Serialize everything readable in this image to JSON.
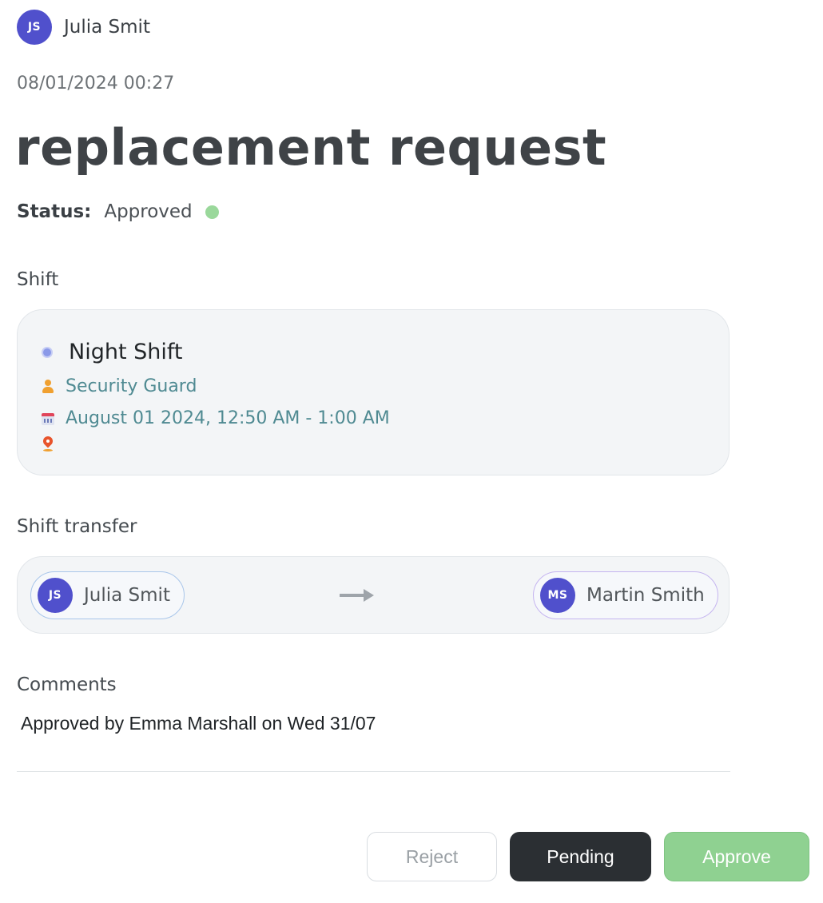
{
  "author": {
    "initials": "JS",
    "name": "Julia Smit",
    "avatar_color": "#5050cc"
  },
  "timestamp": "08/01/2024 00:27",
  "title": "replacement request",
  "status": {
    "label": "Status:",
    "value": "Approved",
    "dot_color": "#9ad89b"
  },
  "shift": {
    "section_label": "Shift",
    "name": "Night Shift",
    "role": "Security Guard",
    "datetime": "August 01 2024, 12:50 AM - 1:00 AM",
    "location": "",
    "icons": {
      "name": "shift-dot-icon",
      "role": "person-icon",
      "datetime": "calendar-icon",
      "location": "location-pin-icon"
    }
  },
  "transfer": {
    "section_label": "Shift transfer",
    "from": {
      "initials": "JS",
      "name": "Julia Smit"
    },
    "to": {
      "initials": "MS",
      "name": "Martin Smith"
    },
    "arrow_icon": "arrow-right-icon"
  },
  "comments": {
    "section_label": "Comments",
    "text": "Approved by Emma Marshall on Wed 31/07"
  },
  "actions": {
    "reject": "Reject",
    "pending": "Pending",
    "approve": "Approve",
    "approve_color": "#8fd191",
    "pending_color": "#2b2f33"
  }
}
